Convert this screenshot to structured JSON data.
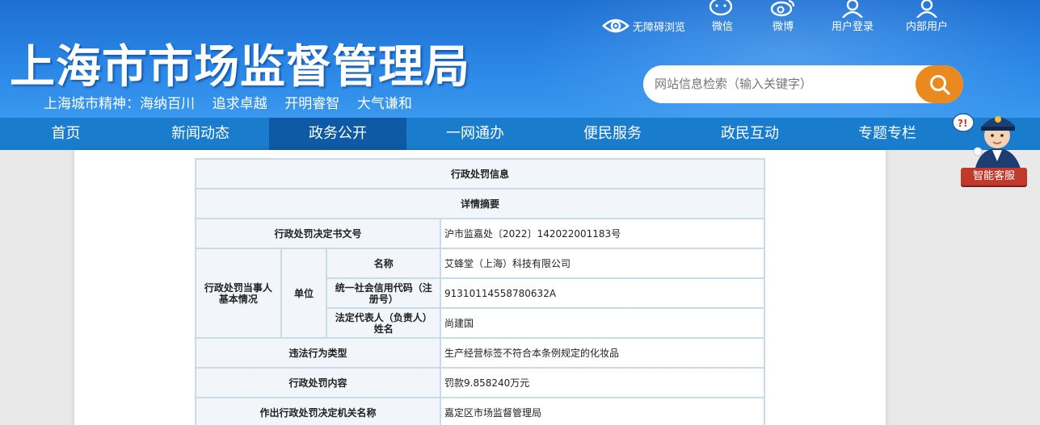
{
  "header": {
    "site_title": "上海市市场监督管理局",
    "motto": "上海城市精神：海纳百川    追求卓越    开明睿智    大气谦和",
    "accessibility_label": "无障碍浏览",
    "tools": [
      {
        "label": "微信",
        "icon": "wechat-icon"
      },
      {
        "label": "微博",
        "icon": "weibo-icon"
      },
      {
        "label": "用户登录",
        "icon": "user-icon"
      },
      {
        "label": "内部用户",
        "icon": "user-icon"
      }
    ],
    "search_placeholder": "网站信息检索（输入关键字）"
  },
  "nav": {
    "items": [
      "首页",
      "新闻动态",
      "政务公开",
      "一网通办",
      "便民服务",
      "政民互动",
      "专题专栏"
    ],
    "active": "政务公开"
  },
  "robot": {
    "label": "智能客服"
  },
  "table": {
    "title": "行政处罚信息",
    "subtitle": "详情摘要",
    "doc_no_label": "行政处罚决定书文号",
    "doc_no_value": "沪市监嘉处〔2022〕142022001183号",
    "party_label": "行政处罚当事人基本情况",
    "unit_label": "单位",
    "name_label": "名称",
    "name_value": "艾蜂堂（上海）科技有限公司",
    "credit_label": "统一社会信用代码（注册号）",
    "credit_value": "91310114558780632A",
    "rep_label": "法定代表人（负责人）姓名",
    "rep_value": "尚建国",
    "violation_label": "违法行为类型",
    "violation_value": "生产经营标签不符合本条例规定的化妆品",
    "penalty_label": "行政处罚内容",
    "penalty_value": "罚款9.858240万元",
    "authority_label": "作出行政处罚决定机关名称",
    "authority_value": "嘉定区市场监督管理局"
  },
  "colors": {
    "header_blue": "#2a86e6",
    "nav_blue": "#1a7ccd",
    "nav_active": "#0e5aa6",
    "search_orange": "#ea8a1e",
    "table_border": "#c9dbe9",
    "table_header_bg": "#f2f6fb"
  }
}
